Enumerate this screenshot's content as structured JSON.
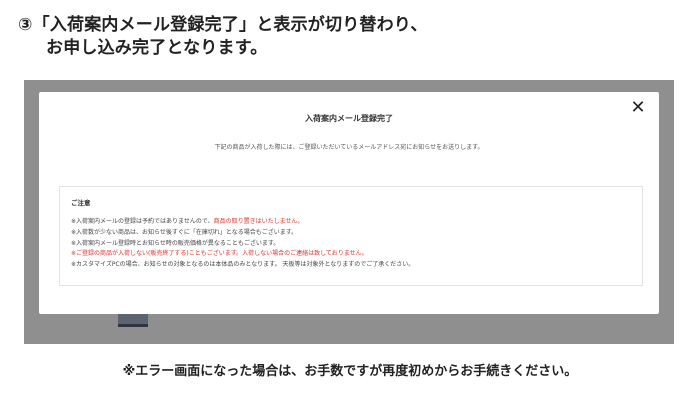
{
  "instruction": {
    "line1": "③「入荷案内メール登録完了」と表示が切り替わり、",
    "line2": "お申し込み完了となります。"
  },
  "modal": {
    "close_icon": "✕",
    "title": "入荷案内メール登録完了",
    "message": "下記の商品が入荷した際には、ご登録いただいているメールアドレス宛にお知らせをお送りします。",
    "notice": {
      "title": "ご注意",
      "items": [
        {
          "text": "※入荷案内メールの登録は予約ではありませんので、",
          "highlight": "商品の取り置きはいたしません。"
        },
        {
          "text": "※入荷数が少ない商品は、お知らせ後すぐに「在庫切れ」となる場合もございます。",
          "highlight": ""
        },
        {
          "text": "※入荷案内メール登録時とお知らせ時の販売価格が異なることもございます。",
          "highlight": ""
        },
        {
          "text": "※ご登録の商品が",
          "highlight": "入荷しない(販売終了する)こともございます。入荷しない場合のご連絡は致しておりません。"
        },
        {
          "text": "※カスタマイズPCの場合、お知らせの対象となるのは本体品のみとなります。 天板等は対象外となりますのでご了承ください。",
          "highlight": ""
        }
      ]
    }
  },
  "footer_note": "※エラー画面になった場合は、お手数ですが再度初めからお手続きください。",
  "colors": {
    "accent_red": "#e0302a",
    "overlay_gray": "#8f8f8f"
  }
}
